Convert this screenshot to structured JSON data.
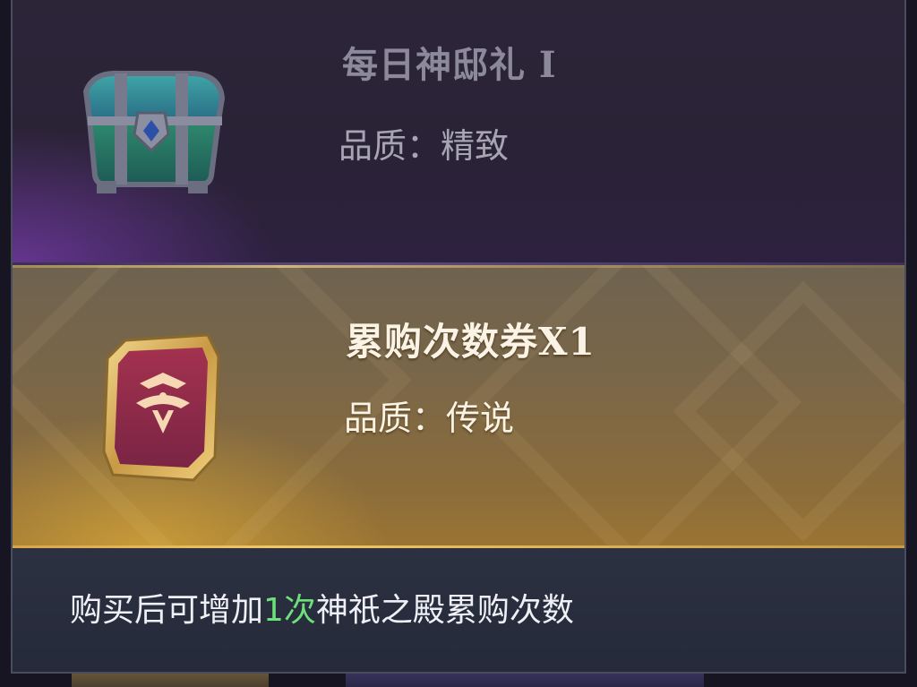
{
  "items": [
    {
      "title": "每日神邸礼 I",
      "quality_label": "品质：",
      "quality_value": "精致",
      "icon": "treasure-chest-icon"
    },
    {
      "title": "累购次数券X1",
      "quality_label": "品质：",
      "quality_value": "传说",
      "icon": "legendary-ticket-icon"
    }
  ],
  "description": {
    "prefix": "购买后可增加",
    "highlight": "1次",
    "suffix": "神祇之殿累购次数"
  },
  "colors": {
    "highlight": "#6ee07a",
    "gold_row": "#8c6d3a",
    "purple_row": "#2c2538"
  }
}
